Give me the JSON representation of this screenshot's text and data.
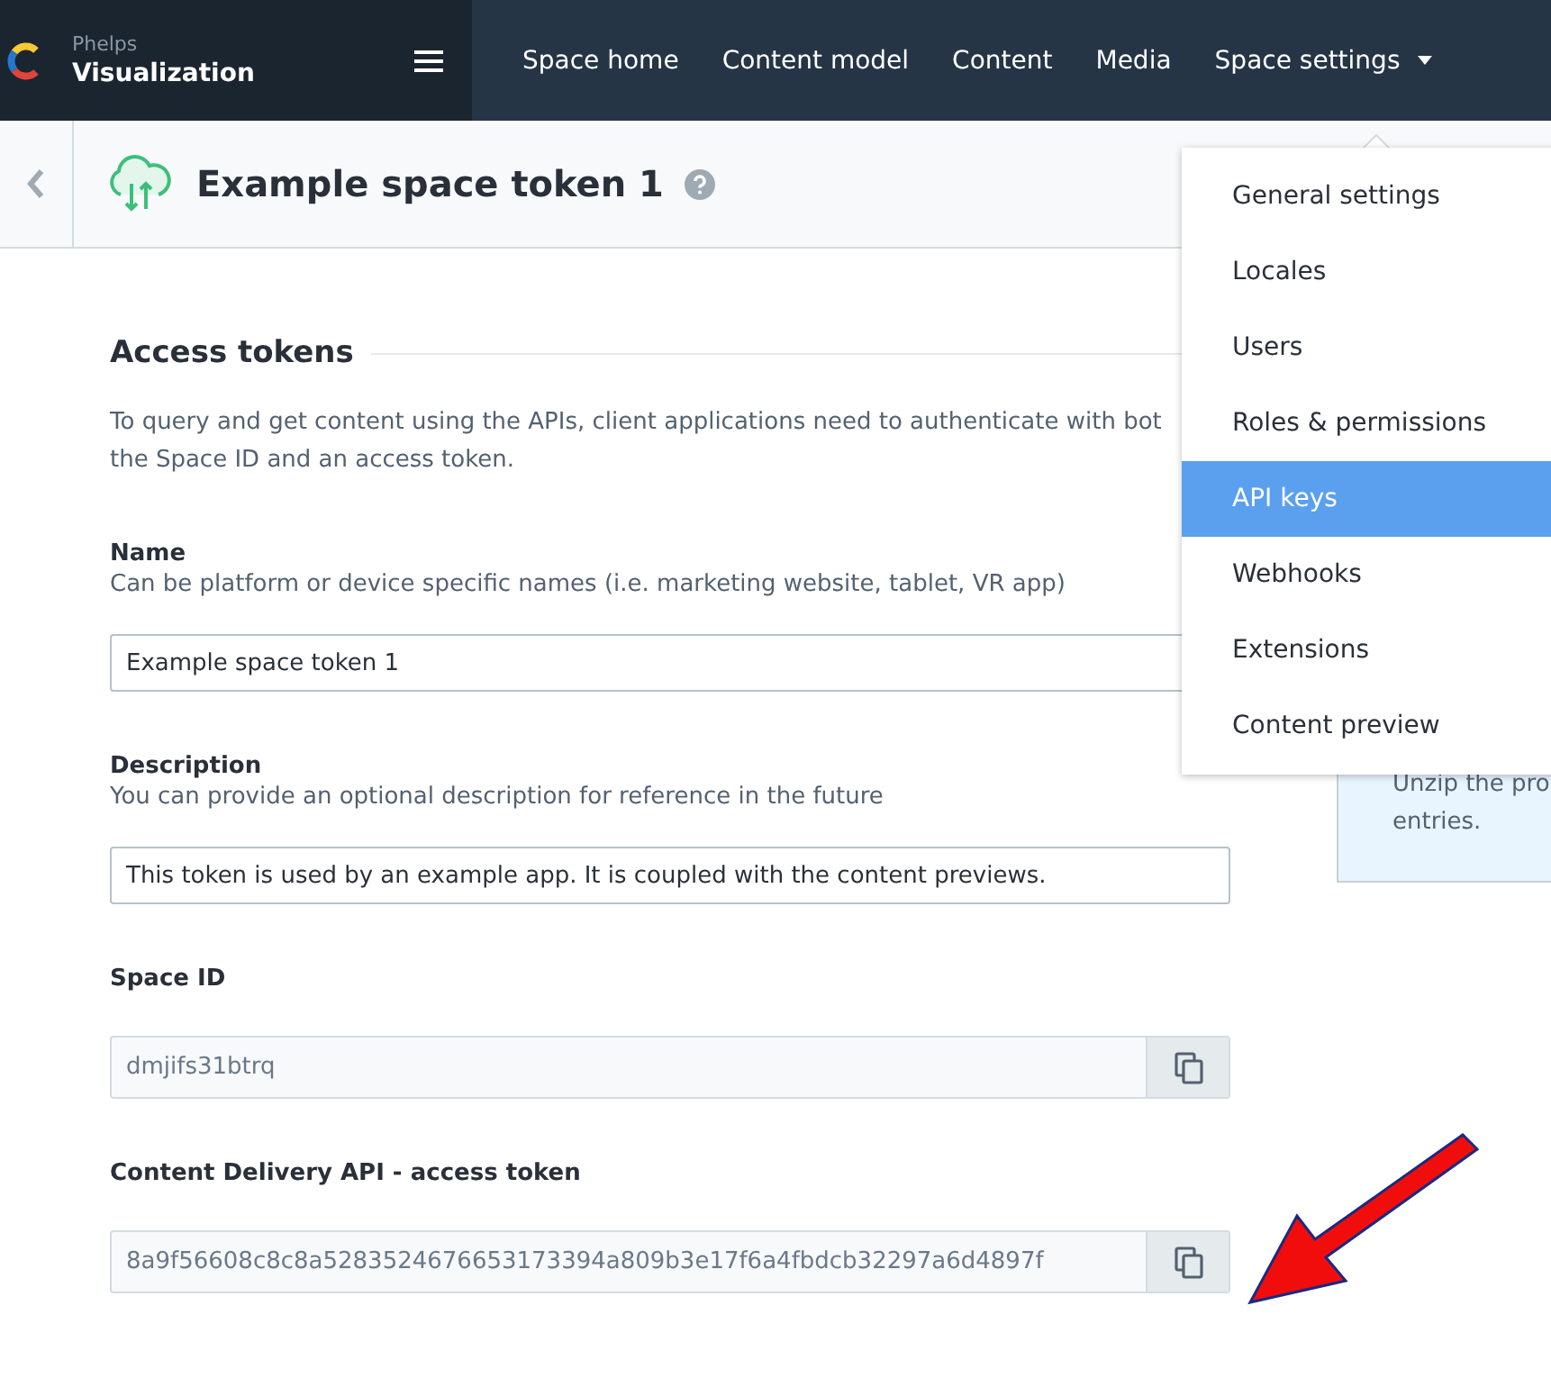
{
  "brand": {
    "org": "Phelps",
    "space": "Visualization"
  },
  "nav": [
    {
      "label": "Space home",
      "kind": "link"
    },
    {
      "label": "Content model",
      "kind": "link"
    },
    {
      "label": "Content",
      "kind": "link"
    },
    {
      "label": "Media",
      "kind": "link"
    },
    {
      "label": "Space settings",
      "kind": "dropdown"
    }
  ],
  "header": {
    "title": "Example space token 1"
  },
  "section": {
    "title": "Access tokens",
    "intro_lines": [
      "To query and get content using the APIs, client applications need to authenticate with bot",
      "the Space ID and an access token."
    ]
  },
  "fields": [
    {
      "kind": "text",
      "label": "Name",
      "hint": "Can be platform or device specific names (i.e. marketing website, tablet, VR app)",
      "value": "Example space token 1"
    },
    {
      "kind": "text",
      "label": "Description",
      "hint": "You can provide an optional description for reference in the future",
      "value": "This token is used by an example app. It is coupled with the content previews."
    },
    {
      "kind": "copy",
      "label": "Space ID",
      "value": "dmjifs31btrq"
    },
    {
      "kind": "copy",
      "label": "Content Delivery API - access token",
      "value": "8a9f56608c8c8a5283524676653173394a809b3e17f6a4fbdcb32297a6d4897f"
    }
  ],
  "info_box": {
    "lines": [
      "Unzip the pro",
      "entries."
    ]
  },
  "menu": [
    {
      "label": "General settings",
      "selected": false
    },
    {
      "label": "Locales",
      "selected": false
    },
    {
      "label": "Users",
      "selected": false
    },
    {
      "label": "Roles & permissions",
      "selected": false
    },
    {
      "label": "API keys",
      "selected": true
    },
    {
      "label": "Webhooks",
      "selected": false
    },
    {
      "label": "Extensions",
      "selected": false
    },
    {
      "label": "Content preview",
      "selected": false
    }
  ]
}
